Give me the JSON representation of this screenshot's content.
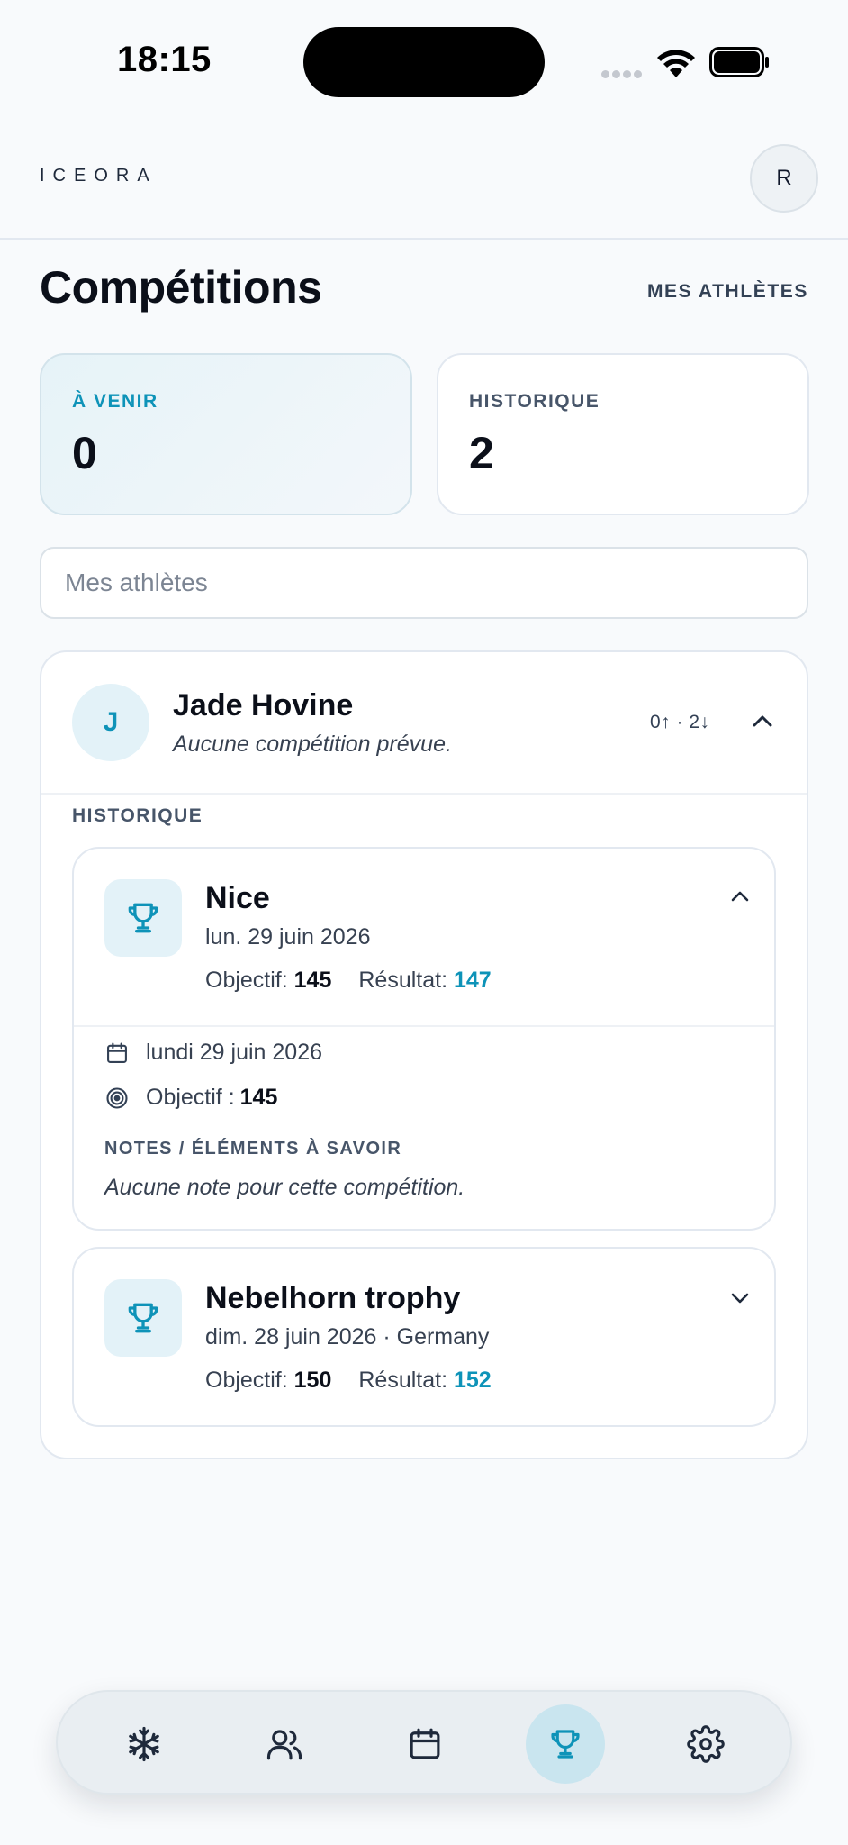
{
  "status_bar": {
    "time": "18:15"
  },
  "header": {
    "logo": "ICEORA",
    "avatar_initial": "R"
  },
  "page": {
    "title": "Compétitions",
    "athletes_link": "MES ATHLÈTES"
  },
  "stats": [
    {
      "label": "À VENIR",
      "value": "0"
    },
    {
      "label": "HISTORIQUE",
      "value": "2"
    }
  ],
  "search": {
    "placeholder": "Mes athlètes",
    "value": ""
  },
  "athlete": {
    "initial": "J",
    "name": "Jade Hovine",
    "subtitle": "Aucune compétition prévue.",
    "counts": "0↑ · 2↓",
    "section_label": "HISTORIQUE",
    "competitions": [
      {
        "name": "Nice",
        "date": "lun. 29 juin 2026",
        "goal_label": "Objectif:",
        "goal": "145",
        "result_label": "Résultat:",
        "result": "147",
        "expanded": true,
        "details": {
          "full_date": "lundi 29 juin 2026",
          "goal_label": "Objectif :",
          "goal": "145",
          "notes_label": "NOTES / ÉLÉMENTS À SAVOIR",
          "notes": "Aucune note pour cette compétition."
        }
      },
      {
        "name": "Nebelhorn trophy",
        "date": "dim. 28 juin 2026 · Germany",
        "goal_label": "Objectif:",
        "goal": "150",
        "result_label": "Résultat:",
        "result": "152",
        "expanded": false
      }
    ]
  },
  "nav": {
    "items": [
      {
        "icon": "snowflake-icon",
        "active": false
      },
      {
        "icon": "users-icon",
        "active": false
      },
      {
        "icon": "calendar-icon",
        "active": false
      },
      {
        "icon": "trophy-icon",
        "active": true
      },
      {
        "icon": "gear-icon",
        "active": false
      }
    ]
  },
  "colors": {
    "accent": "#0e93b8",
    "background": "#f8fafc",
    "text": "#0b0f19"
  }
}
